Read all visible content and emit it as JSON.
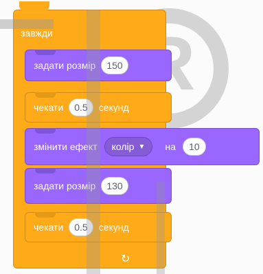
{
  "script": {
    "forever_label": "завжди",
    "blocks": [
      {
        "type": "looks",
        "label": "задати розмір",
        "value": "150"
      },
      {
        "type": "control",
        "label_before": "чекати",
        "value": "0.5",
        "label_after": "секунд"
      },
      {
        "type": "looks",
        "label_before": "змінити ефект",
        "dropdown": "колір",
        "label_mid": "на",
        "value": "10"
      },
      {
        "type": "looks",
        "label": "задати розмір",
        "value": "130"
      },
      {
        "type": "control",
        "label_before": "чекати",
        "value": "0.5",
        "label_after": "секунд"
      }
    ],
    "loop_icon": "↻"
  },
  "colors": {
    "looks": "#9966ff",
    "control": "#ffab19",
    "watermark": "#8c8c8c"
  },
  "icons": {
    "loop": "loop-arrow-icon",
    "dropdown": "caret-down-icon",
    "watermark": "registered-mark-icon"
  }
}
